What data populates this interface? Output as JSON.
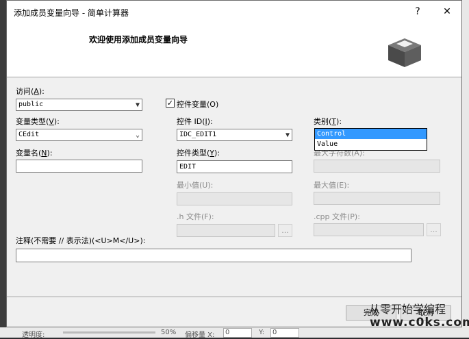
{
  "window": {
    "title": "添加成员变量向导 - 简单计算器",
    "help": "?",
    "close": "✕"
  },
  "header": {
    "title": "欢迎使用添加成员变量向导",
    "icon": "box-icon"
  },
  "access": {
    "label_prefix": "访问(",
    "hotkey": "A",
    "label_suffix": "):",
    "value": "public"
  },
  "control_var": {
    "label": "控件变量(O)",
    "checked": "✓"
  },
  "var_type": {
    "label_prefix": "变量类型(",
    "hotkey": "V",
    "label_suffix": "):",
    "value": "CEdit"
  },
  "control_id": {
    "label_prefix": "控件 ID(",
    "hotkey": "I",
    "label_suffix": "):",
    "value": "IDC_EDIT1"
  },
  "category": {
    "label_prefix": "类别(",
    "hotkey": "T",
    "label_suffix": "):",
    "options": [
      "Control",
      "Value"
    ],
    "selected": "Control"
  },
  "var_name": {
    "label_prefix": "变量名(",
    "hotkey": "N",
    "label_suffix": "):",
    "value": ""
  },
  "control_type": {
    "label_prefix": "控件类型(",
    "hotkey": "Y",
    "label_suffix": "):",
    "value": "EDIT"
  },
  "max_chars": {
    "label": "最大字符数(A):",
    "value": ""
  },
  "min_value": {
    "label": "最小值(U):",
    "value": ""
  },
  "max_value": {
    "label": "最大值(E):",
    "value": ""
  },
  "h_file": {
    "label": ".h 文件(F):",
    "value": "",
    "browse": "..."
  },
  "cpp_file": {
    "label": ".cpp 文件(P):",
    "value": "",
    "browse": "..."
  },
  "comment": {
    "label": "注释(不需要 // 表示法)(<U>M</U>):",
    "value": ""
  },
  "buttons": {
    "finish": "完成",
    "cancel": "取消"
  },
  "watermark": {
    "line1": "从零开始学编程",
    "line2": "www.c0ks.com"
  },
  "statusbar": {
    "opacity_label": "透明度:",
    "opacity_value": "50%",
    "offset_label": "偏移量 X:",
    "offset_x": "0",
    "y_label": "Y:",
    "offset_y": "0"
  }
}
